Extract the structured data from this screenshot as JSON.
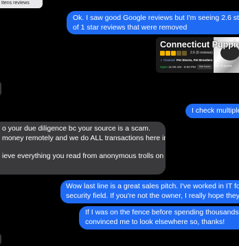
{
  "top_tab": {
    "label": "ttens reviews"
  },
  "messages": {
    "m1": {
      "line1": "Ok. I saw good Google reviews but I'm seeing 2.6 stars on",
      "line2": "of 1 star reviews that were removed"
    },
    "m2": {
      "line1": "I check multiple"
    },
    "m3": {
      "line1": "o your due diligence bc your source is a scam.",
      "line2": "money remotely and we do ALL transactions here in",
      "line3": "ieve everything you read from anonymous trolls on the"
    },
    "m4": {
      "line1": "Wow last line is a great sales pitch. I've worked in IT for ove",
      "line2": "security field. If you're not the owner, I really hope they see"
    },
    "m5": {
      "line1": "If I was on the fence before spending thousands of d",
      "line2": "convinced me to look elsewhere so, thanks!"
    }
  },
  "business_card": {
    "title": "Connecticut Puppie",
    "rating_text": "2.6 (6 reviews)",
    "stars": 2.6,
    "claimed": "Claimed",
    "categories": "Pet Stores, Pet Breeders",
    "open_label": "Open",
    "hours": "11:00 AM - 8:00 PM",
    "hours_button": "See hours",
    "photos_button": "See 73 photos"
  },
  "colors": {
    "sent": "#1f6bf4",
    "received": "#3a3a3c",
    "star": "#f4b400"
  }
}
